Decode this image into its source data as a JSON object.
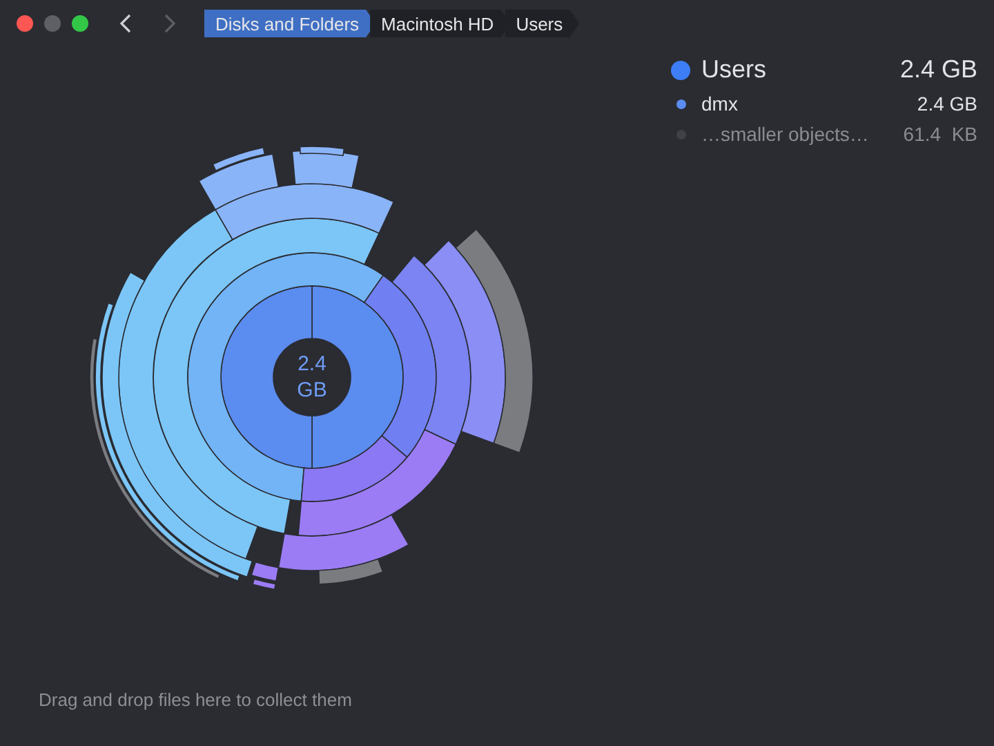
{
  "window": {
    "traffic_lights": [
      {
        "color": "#fc5753"
      },
      {
        "color": "#5f6066"
      },
      {
        "color": "#33c748"
      }
    ]
  },
  "breadcrumb": [
    {
      "label": "Disks and Folders",
      "selected": true
    },
    {
      "label": "Macintosh HD",
      "selected": false
    },
    {
      "label": "Users",
      "selected": false
    }
  ],
  "center": {
    "size": "2.4 GB"
  },
  "summary": {
    "name": "Users",
    "size": "2.4 GB",
    "color": "#3d7ef7"
  },
  "items": [
    {
      "name": "dmx",
      "size": "2.4 GB",
      "color": "#5b8cf0",
      "dimmed": false
    },
    {
      "name": "…smaller objects…",
      "size": "61.4  KB",
      "color": "#3f4147",
      "dimmed": true
    }
  ],
  "hint": "Drag and drop files here to collect them"
}
